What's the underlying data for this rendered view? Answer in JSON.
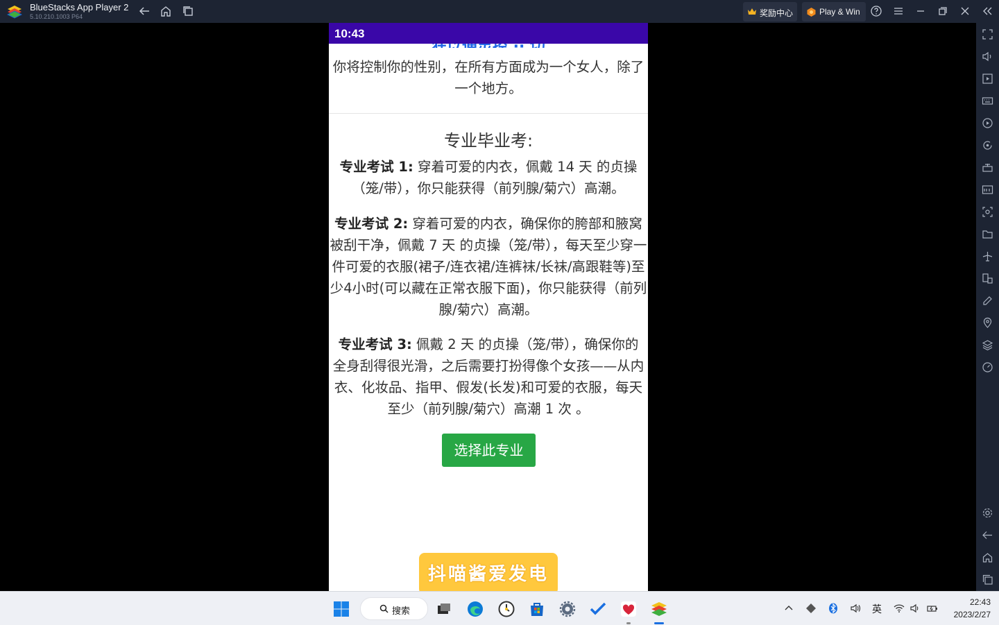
{
  "titlebar": {
    "app_name": "BlueStacks App Player 2",
    "version": "5.10.210.1003 P64",
    "reward_label": "奖励中心",
    "playwin_label": "Play & Win"
  },
  "phone": {
    "status_time": "10:43",
    "cut_heading": "狂以通灵控 ·· 切",
    "intro_text": "你将控制你的性别，在所有方面成为一个女人，除了一个地方。",
    "section_title": "专业毕业考:",
    "exams": [
      {
        "label": "专业考试 1:",
        "text": "穿着可爱的内衣，佩戴 14 天 的贞操（笼/带），你只能获得（前列腺/菊穴）高潮。"
      },
      {
        "label": "专业考试 2:",
        "text": "穿着可爱的内衣，确保你的胯部和腋窝被刮干净，佩戴 7 天 的贞操（笼/带），每天至少穿一件可爱的衣服(裙子/连衣裙/连裤袜/长袜/高跟鞋等)至少4小时(可以藏在正常衣服下面)，你只能获得（前列腺/菊穴）高潮。"
      },
      {
        "label": "专业考试 3:",
        "text": "佩戴 2 天 的贞操（笼/带），确保你的全身刮得很光滑，之后需要打扮得像个女孩——从内衣、化妆品、指甲、假发(长发)和可爱的衣服，每天至少（前列腺/菊穴）高潮 1 次 。"
      }
    ],
    "choose_button": "选择此专业",
    "banner_text": "抖喵酱爱发电"
  },
  "taskbar": {
    "search_label": "搜索",
    "ime_label": "英",
    "clock_time": "22:43",
    "clock_date": "2023/2/27"
  },
  "colors": {
    "titlebar_bg": "#1d2433",
    "statusbar_bg": "#3a07a8",
    "button_green": "#28a745",
    "banner_yellow": "#ffc83d"
  }
}
